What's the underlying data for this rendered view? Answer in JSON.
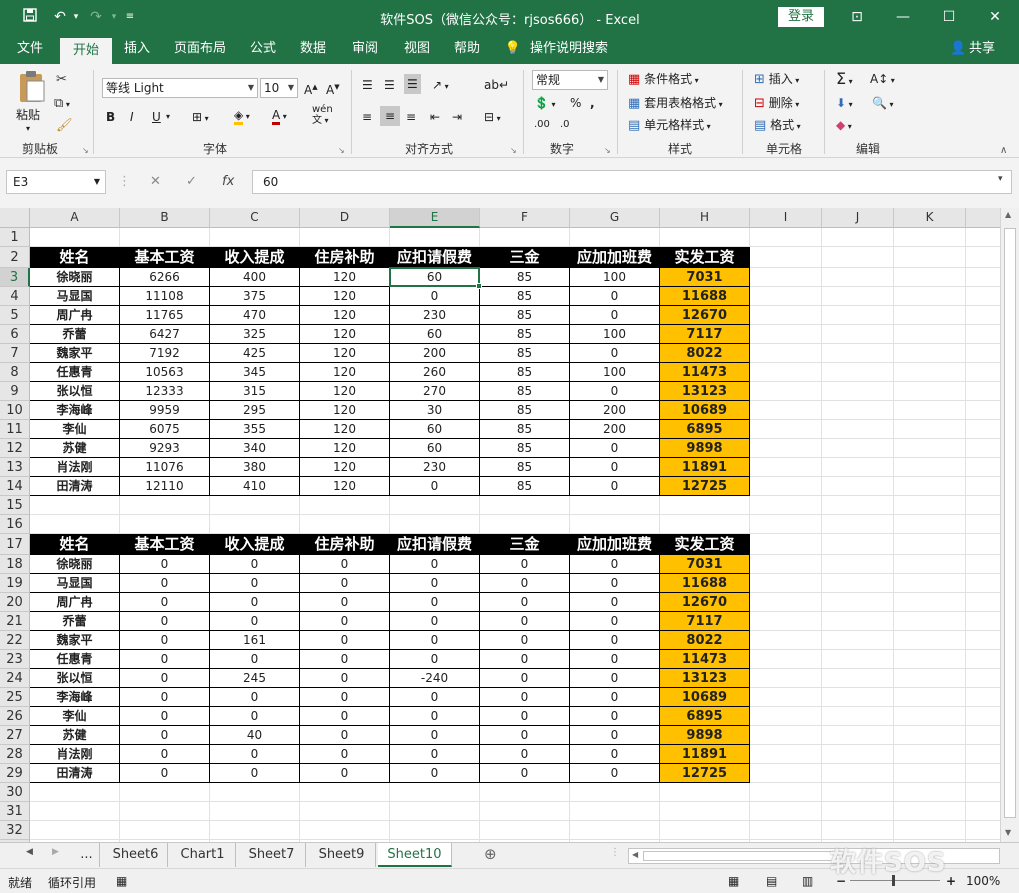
{
  "titlebar": {
    "title": "软件SOS（微信公众号：rjsos666）  -  Excel",
    "login": "登录",
    "save_icon": "save-icon",
    "undo_icon": "undo-icon",
    "redo_icon": "redo-icon"
  },
  "tabs": [
    "文件",
    "开始",
    "插入",
    "页面布局",
    "公式",
    "数据",
    "审阅",
    "视图",
    "帮助",
    "操作说明搜索"
  ],
  "share": "共享",
  "ribbon": {
    "clipboard": {
      "paste": "粘贴",
      "label": "剪贴板"
    },
    "font": {
      "name": "等线 Light",
      "size": "10",
      "label": "字体"
    },
    "align": {
      "label": "对齐方式"
    },
    "number": {
      "format": "常规",
      "label": "数字"
    },
    "styles": {
      "cond": "条件格式",
      "table": "套用表格格式",
      "cell": "单元格样式",
      "label": "样式"
    },
    "cells": {
      "insert": "插入",
      "delete": "删除",
      "format": "格式",
      "label": "单元格"
    },
    "edit": {
      "label": "编辑"
    }
  },
  "formula_bar": {
    "name_box": "E3",
    "value": "60"
  },
  "columns": [
    "A",
    "B",
    "C",
    "D",
    "E",
    "F",
    "G",
    "H",
    "I",
    "J",
    "K"
  ],
  "rows": [
    "1",
    "2",
    "3",
    "4",
    "5",
    "6",
    "7",
    "8",
    "9",
    "10",
    "11",
    "12",
    "13",
    "14",
    "15",
    "16",
    "17",
    "18",
    "19",
    "20",
    "21",
    "22",
    "23",
    "24",
    "25",
    "26",
    "27",
    "28",
    "29",
    "30",
    "31",
    "32",
    "33"
  ],
  "table1": {
    "headers": [
      "姓名",
      "基本工资",
      "收入提成",
      "住房补助",
      "应扣请假费",
      "三金",
      "应加加班费",
      "实发工资"
    ],
    "rows": [
      [
        "徐晓丽",
        "6266",
        "400",
        "120",
        "60",
        "85",
        "100",
        "7031"
      ],
      [
        "马显国",
        "11108",
        "375",
        "120",
        "0",
        "85",
        "0",
        "11688"
      ],
      [
        "周广冉",
        "11765",
        "470",
        "120",
        "230",
        "85",
        "0",
        "12670"
      ],
      [
        "乔蕾",
        "6427",
        "325",
        "120",
        "60",
        "85",
        "100",
        "7117"
      ],
      [
        "魏家平",
        "7192",
        "425",
        "120",
        "200",
        "85",
        "0",
        "8022"
      ],
      [
        "任惠青",
        "10563",
        "345",
        "120",
        "260",
        "85",
        "100",
        "11473"
      ],
      [
        "张以恒",
        "12333",
        "315",
        "120",
        "270",
        "85",
        "0",
        "13123"
      ],
      [
        "李海峰",
        "9959",
        "295",
        "120",
        "30",
        "85",
        "200",
        "10689"
      ],
      [
        "李仙",
        "6075",
        "355",
        "120",
        "60",
        "85",
        "200",
        "6895"
      ],
      [
        "苏健",
        "9293",
        "340",
        "120",
        "60",
        "85",
        "0",
        "9898"
      ],
      [
        "肖法刚",
        "11076",
        "380",
        "120",
        "230",
        "85",
        "0",
        "11891"
      ],
      [
        "田清涛",
        "12110",
        "410",
        "120",
        "0",
        "85",
        "0",
        "12725"
      ]
    ]
  },
  "table2": {
    "headers": [
      "姓名",
      "基本工资",
      "收入提成",
      "住房补助",
      "应扣请假费",
      "三金",
      "应加加班费",
      "实发工资"
    ],
    "rows": [
      [
        "徐晓丽",
        "0",
        "0",
        "0",
        "0",
        "0",
        "0",
        "7031"
      ],
      [
        "马显国",
        "0",
        "0",
        "0",
        "0",
        "0",
        "0",
        "11688"
      ],
      [
        "周广冉",
        "0",
        "0",
        "0",
        "0",
        "0",
        "0",
        "12670"
      ],
      [
        "乔蕾",
        "0",
        "0",
        "0",
        "0",
        "0",
        "0",
        "7117"
      ],
      [
        "魏家平",
        "0",
        "161",
        "0",
        "0",
        "0",
        "0",
        "8022"
      ],
      [
        "任惠青",
        "0",
        "0",
        "0",
        "0",
        "0",
        "0",
        "11473"
      ],
      [
        "张以恒",
        "0",
        "245",
        "0",
        "-240",
        "0",
        "0",
        "13123"
      ],
      [
        "李海峰",
        "0",
        "0",
        "0",
        "0",
        "0",
        "0",
        "10689"
      ],
      [
        "李仙",
        "0",
        "0",
        "0",
        "0",
        "0",
        "0",
        "6895"
      ],
      [
        "苏健",
        "0",
        "40",
        "0",
        "0",
        "0",
        "0",
        "9898"
      ],
      [
        "肖法刚",
        "0",
        "0",
        "0",
        "0",
        "0",
        "0",
        "11891"
      ],
      [
        "田清涛",
        "0",
        "0",
        "0",
        "0",
        "0",
        "0",
        "12725"
      ]
    ]
  },
  "sheets": {
    "more": "...",
    "tabs": [
      "Sheet6",
      "Chart1",
      "Sheet7",
      "Sheet9",
      "Sheet10"
    ],
    "active": "Sheet10"
  },
  "status": {
    "ready": "就绪",
    "circular": "循环引用",
    "zoom": "100%"
  },
  "watermark": "软件SOS",
  "colors": {
    "excel_green": "#217346",
    "header_black": "#000000",
    "payout_orange": "#ffc000"
  }
}
